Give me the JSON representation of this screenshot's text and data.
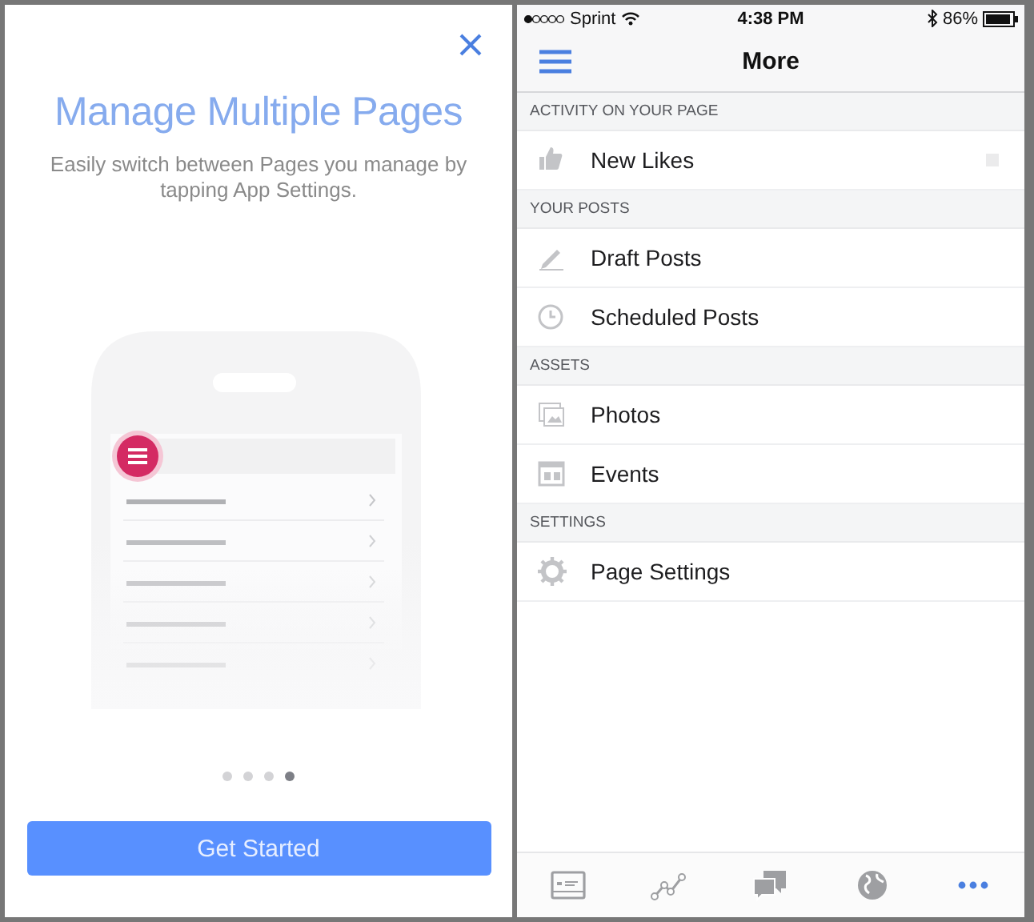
{
  "intro": {
    "title": "Manage Multiple Pages",
    "subtitle": "Easily switch between Pages you manage by tapping App Settings.",
    "page_dots": [
      {
        "selected": false
      },
      {
        "selected": false
      },
      {
        "selected": false
      },
      {
        "selected": true
      }
    ],
    "button": "Get Started"
  },
  "status_bar": {
    "carrier": "Sprint",
    "time": "4:38 PM",
    "battery": "86%"
  },
  "nav_bar": {
    "title": "More"
  },
  "sections": [
    {
      "header": "ACTIVITY ON YOUR PAGE",
      "items": [
        {
          "label": "New Likes",
          "kind": "likes"
        }
      ]
    },
    {
      "header": "YOUR POSTS",
      "items": [
        {
          "label": "Draft Posts",
          "kind": "draft"
        },
        {
          "label": "Scheduled Posts",
          "kind": "scheduled"
        }
      ]
    },
    {
      "header": "ASSETS",
      "items": [
        {
          "label": "Photos",
          "kind": "photos"
        },
        {
          "label": "Events",
          "kind": "events"
        }
      ]
    },
    {
      "header": "SETTINGS",
      "items": [
        {
          "label": "Page Settings",
          "kind": "settings"
        }
      ]
    }
  ],
  "tab_bar": [
    {
      "kind": "page",
      "selected": false
    },
    {
      "kind": "insights",
      "selected": false
    },
    {
      "kind": "messages",
      "selected": false
    },
    {
      "kind": "globe",
      "selected": false
    },
    {
      "kind": "more",
      "selected": true
    }
  ]
}
